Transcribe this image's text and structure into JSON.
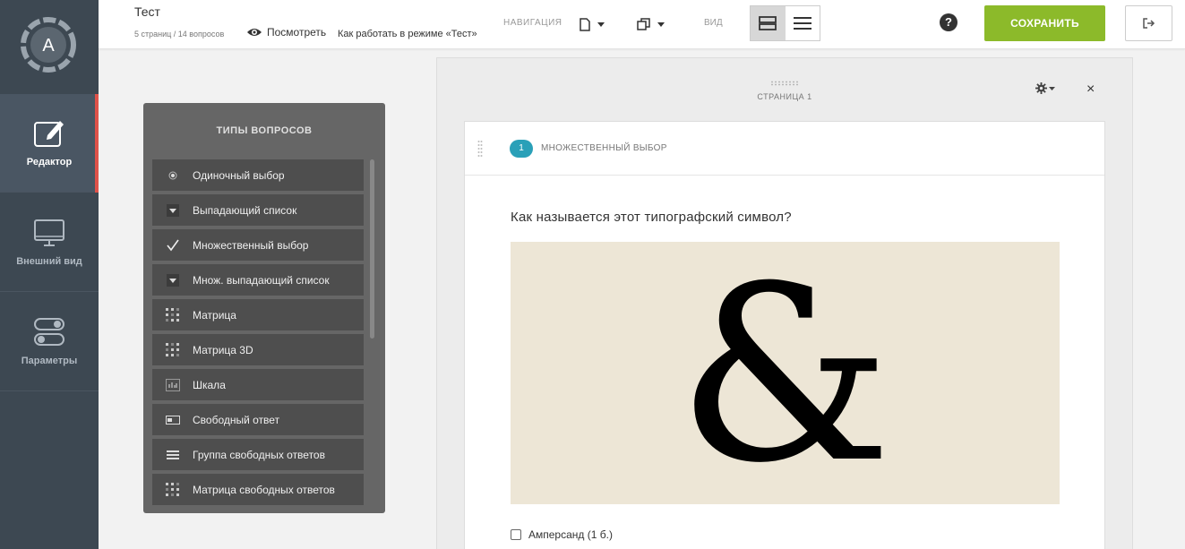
{
  "sidebar": {
    "items": [
      {
        "label": "Редактор",
        "icon": "edit-icon"
      },
      {
        "label": "Внешний вид",
        "icon": "monitor-icon"
      },
      {
        "label": "Параметры",
        "icon": "toggles-icon"
      }
    ]
  },
  "topbar": {
    "title": "Тест",
    "meta": "5 страниц / 14 вопросов",
    "preview_label": "Посмотреть",
    "howto_label": "Как работать в режиме «Тест»",
    "nav_label": "НАВИГАЦИЯ",
    "view_label": "ВИД",
    "save_label": "СОХРАНИТЬ",
    "help_label": "?"
  },
  "question_types": {
    "title": "ТИПЫ ВОПРОСОВ",
    "items": [
      {
        "label": "Одиночный выбор",
        "icon": "radio-icon"
      },
      {
        "label": "Выпадающий список",
        "icon": "dropdown-icon"
      },
      {
        "label": "Множественный выбор",
        "icon": "checkmark-icon"
      },
      {
        "label": "Множ. выпадающий список",
        "icon": "dropdown-icon"
      },
      {
        "label": "Матрица",
        "icon": "matrix-icon"
      },
      {
        "label": "Матрица 3D",
        "icon": "matrix-icon"
      },
      {
        "label": "Шкала",
        "icon": "scale-icon"
      },
      {
        "label": "Свободный ответ",
        "icon": "textfield-icon"
      },
      {
        "label": "Группа свободных ответов",
        "icon": "lines-icon"
      },
      {
        "label": "Матрица свободных ответов",
        "icon": "matrix-icon"
      }
    ]
  },
  "page": {
    "label": "СТРАНИЦА 1",
    "close_label": "×"
  },
  "question": {
    "number": "1",
    "type": "МНОЖЕСТВЕННЫЙ ВЫБОР",
    "text": "Как называется этот типографский символ?",
    "image_glyph": "&",
    "answers": [
      {
        "label": "Амперсанд (1 б.)",
        "checked": false
      }
    ]
  },
  "colors": {
    "sidebar": "#3d4852",
    "active_marker": "#e0524a",
    "save": "#8cba2a",
    "badge": "#2aa0b8",
    "panel": "#666666"
  }
}
